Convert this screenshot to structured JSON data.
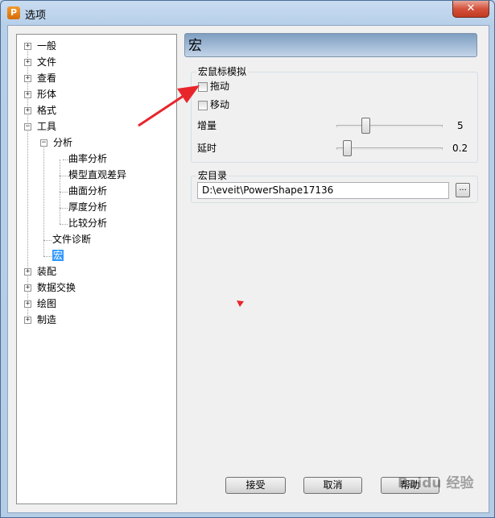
{
  "window": {
    "title": "选项",
    "app_icon_letter": "P",
    "close_symbol": "✕"
  },
  "tree": {
    "items": [
      {
        "label": "一般",
        "expander": "+"
      },
      {
        "label": "文件",
        "expander": "+"
      },
      {
        "label": "查看",
        "expander": "+"
      },
      {
        "label": "形体",
        "expander": "+"
      },
      {
        "label": "格式",
        "expander": "+"
      },
      {
        "label": "工具",
        "expander": "−"
      },
      {
        "label": "分析",
        "expander": "−"
      },
      {
        "label": "曲率分析"
      },
      {
        "label": "模型直观差异"
      },
      {
        "label": "曲面分析"
      },
      {
        "label": "厚度分析"
      },
      {
        "label": "比较分析"
      },
      {
        "label": "文件诊断"
      },
      {
        "label": "宏",
        "selected": true
      },
      {
        "label": "装配",
        "expander": "+"
      },
      {
        "label": "数据交换",
        "expander": "+"
      },
      {
        "label": "绘图",
        "expander": "+"
      },
      {
        "label": "制造",
        "expander": "+"
      }
    ]
  },
  "panel": {
    "header": "宏",
    "mouse_sim": {
      "title": "宏鼠标模拟",
      "drag_label": "拖动",
      "drag_checked": false,
      "move_label": "移动",
      "move_checked": false,
      "increment_label": "增量",
      "increment_value": "5",
      "delay_label": "延时",
      "delay_value": "0.2"
    },
    "macro_dir": {
      "title": "宏目录",
      "path": "D:\\eveit\\PowerShape17136",
      "browse_label": "..."
    }
  },
  "buttons": {
    "accept": "接受",
    "cancel": "取消",
    "help": "帮助"
  },
  "watermark": "Baidu 经验",
  "colors": {
    "selection": "#3399ff",
    "annotation_arrow": "#e8252a"
  }
}
